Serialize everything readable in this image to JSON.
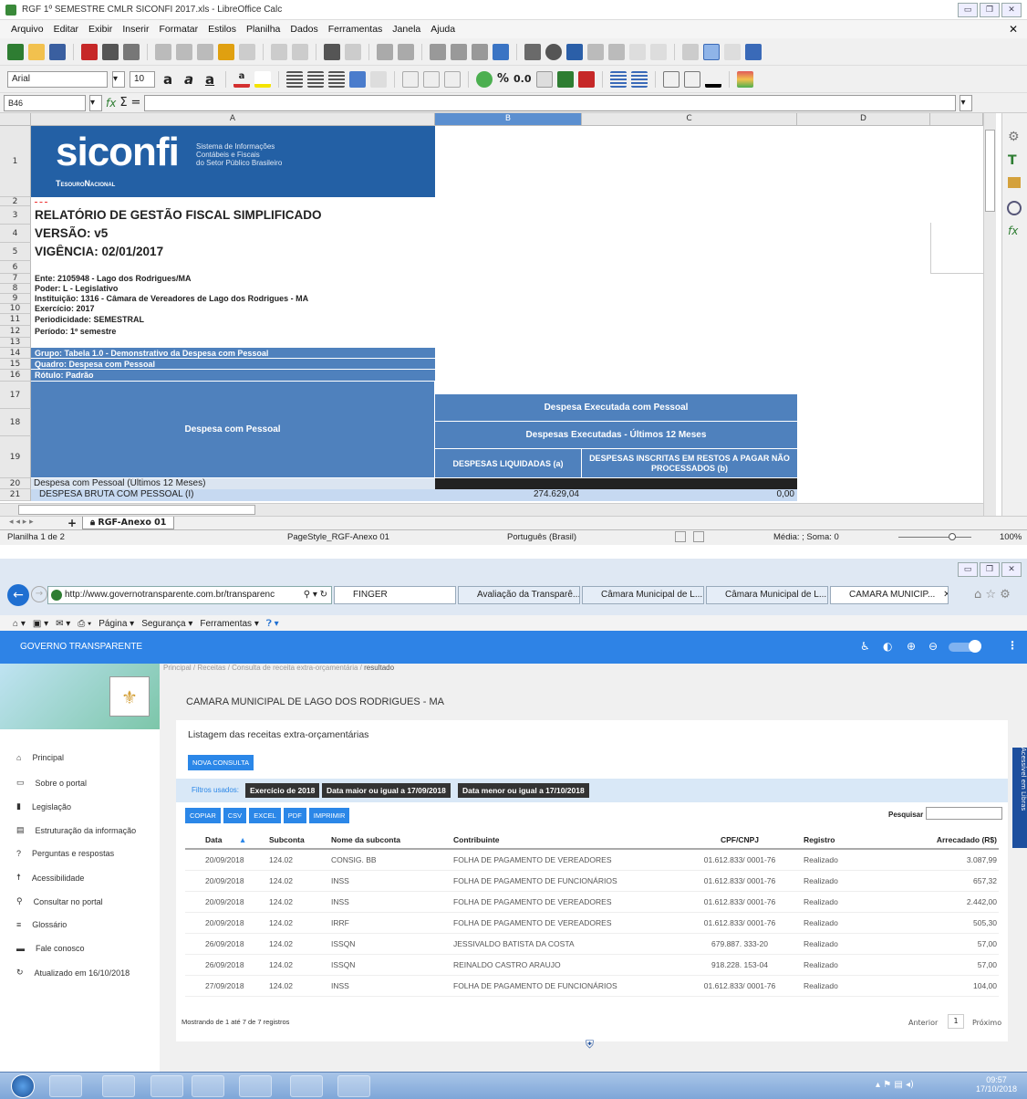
{
  "lo": {
    "title": "RGF 1º SEMESTRE CMLR SICONFI 2017.xls - LibreOffice Calc",
    "menu": [
      "Arquivo",
      "Editar",
      "Exibir",
      "Inserir",
      "Formatar",
      "Estilos",
      "Planilha",
      "Dados",
      "Ferramentas",
      "Janela",
      "Ajuda"
    ],
    "font_name": "Arial",
    "font_size": "10",
    "cell_ref": "B46",
    "columns": [
      "A",
      "B",
      "C",
      "D"
    ],
    "logo": {
      "name": "siconfi",
      "sub1": "Sistema de Informações",
      "sub2": "Contábeis e Fiscais",
      "sub3": "do Setor Público Brasileiro",
      "tesouro": "TesouroNacional"
    },
    "rows": {
      "r3": "RELATÓRIO DE GESTÃO FISCAL SIMPLIFICADO",
      "r4": "VERSÃO: v5",
      "r5": "VIGÊNCIA: 02/01/2017",
      "r7": "Ente: 2105948 - Lago dos Rodrigues/MA",
      "r8": "Poder: L - Legislativo",
      "r9": "Instituição: 1316 - Câmara de Vereadores de Lago dos Rodrigues - MA",
      "r10": "Exercício: 2017",
      "r11": "Periodicidade: SEMESTRAL",
      "r12": "Período: 1º semestre",
      "r14": "Grupo: Tabela 1.0 - Demonstrativo da Despesa com Pessoal",
      "r15": "Quadro: Despesa com Pessoal",
      "r16": "Rótulo: Padrão",
      "r17b": "Despesa Executada com Pessoal",
      "r18a": "Despesa com Pessoal",
      "r18b": "Despesas Executadas - Últimos 12 Meses",
      "r19b": "DESPESAS LIQUIDADAS (a)",
      "r19c": "DESPESAS INSCRITAS EM RESTOS A PAGAR NÃO PROCESSADOS (b)",
      "r20a": "Despesa com Pessoal (Últimos 12 Meses)",
      "r21a": "DESPESA BRUTA COM PESSOAL (I)",
      "r21b": "274.629,04",
      "r21c": "0,00"
    },
    "row_numbers": [
      "1",
      "2",
      "3",
      "4",
      "5",
      "6",
      "7",
      "8",
      "9",
      "10",
      "11",
      "12",
      "13",
      "14",
      "15",
      "16",
      "17",
      "18",
      "19",
      "20",
      "21"
    ],
    "sheet_tab": "RGF-Anexo 01",
    "status": {
      "sheet": "Planilha 1 de 2",
      "style": "PageStyle_RGF-Anexo 01",
      "lang": "Português (Brasil)",
      "sum": "Média: ; Soma: 0",
      "zoom": "100%"
    }
  },
  "ie": {
    "url": "http://www.governotransparente.com.br/transparenc",
    "tabs": [
      "FINGER",
      "Avaliação da Transparê...",
      "Câmara Municipal de L...",
      "Câmara Municipal de L...",
      "CAMARA MUNICIP..."
    ],
    "cmd": [
      "Página ▾",
      "Segurança ▾",
      "Ferramentas ▾"
    ],
    "brand": "GOVERNO TRANSPARENTE",
    "breadcrumb": [
      "Principal",
      "Receitas",
      "Consulta de receita extra-orçamentária",
      "resultado"
    ],
    "entity": "CAMARA MUNICIPAL DE LAGO DOS RODRIGUES - MA",
    "list_title": "Listagem das receitas extra-orçamentárias",
    "new_query": "NOVA CONSULTA",
    "filters_label": "Filtros usados:",
    "filters": [
      "Exercício de 2018",
      "Data maior ou igual a 17/09/2018",
      "Data menor ou igual a 17/10/2018"
    ],
    "export": [
      "COPIAR",
      "CSV",
      "EXCEL",
      "PDF",
      "IMPRIMIR"
    ],
    "search_label": "Pesquisar",
    "headers": [
      "Data",
      "Subconta",
      "Nome da subconta",
      "Contribuinte",
      "CPF/CNPJ",
      "Registro",
      "Arrecadado (R$)"
    ],
    "rows": [
      [
        "20/09/2018",
        "124.02",
        "CONSIG. BB",
        "FOLHA DE PAGAMENTO DE VEREADORES",
        "01.612.833/ 0001-76",
        "Realizado",
        "3.087,99"
      ],
      [
        "20/09/2018",
        "124.02",
        "INSS",
        "FOLHA DE PAGAMENTO DE FUNCIONÁRIOS",
        "01.612.833/ 0001-76",
        "Realizado",
        "657,32"
      ],
      [
        "20/09/2018",
        "124.02",
        "INSS",
        "FOLHA DE PAGAMENTO DE VEREADORES",
        "01.612.833/ 0001-76",
        "Realizado",
        "2.442,00"
      ],
      [
        "20/09/2018",
        "124.02",
        "IRRF",
        "FOLHA DE PAGAMENTO DE VEREADORES",
        "01.612.833/ 0001-76",
        "Realizado",
        "505,30"
      ],
      [
        "26/09/2018",
        "124.02",
        "ISSQN",
        "JESSIVALDO BATISTA DA COSTA",
        "679.887. 333-20",
        "Realizado",
        "57,00"
      ],
      [
        "26/09/2018",
        "124.02",
        "ISSQN",
        "REINALDO CASTRO ARAUJO",
        "918.228. 153-04",
        "Realizado",
        "57,00"
      ],
      [
        "27/09/2018",
        "124.02",
        "INSS",
        "FOLHA DE PAGAMENTO DE FUNCIONÁRIOS",
        "01.612.833/ 0001-76",
        "Realizado",
        "104,00"
      ]
    ],
    "footer_info": "Mostrando de 1 até 7 de 7 registros",
    "prev": "Anterior",
    "page": "1",
    "next": "Próximo",
    "sidebar": [
      {
        "icon": "home-icon",
        "glyph": "⌂",
        "label": "Principal"
      },
      {
        "icon": "folder-icon",
        "glyph": "▭",
        "label": "Sobre o portal"
      },
      {
        "icon": "document-icon",
        "glyph": "▮",
        "label": "Legislação"
      },
      {
        "icon": "structure-icon",
        "glyph": "▤",
        "label": "Estruturação da informação"
      },
      {
        "icon": "question-icon",
        "glyph": "?",
        "label": "Perguntas e respostas"
      },
      {
        "icon": "accessibility-icon",
        "glyph": "☨",
        "label": "Acessibilidade"
      },
      {
        "icon": "search-icon",
        "glyph": "⚲",
        "label": "Consultar no portal"
      },
      {
        "icon": "list-icon",
        "glyph": "≡",
        "label": "Glossário"
      },
      {
        "icon": "chat-icon",
        "glyph": "▬",
        "label": "Fale conosco"
      },
      {
        "icon": "history-icon",
        "glyph": "↻",
        "label": "Atualizado em 16/10/2018"
      }
    ],
    "vlibras": "Acessível em Libras"
  },
  "taskbar": {
    "time": "09:57",
    "date": "17/10/2018"
  }
}
